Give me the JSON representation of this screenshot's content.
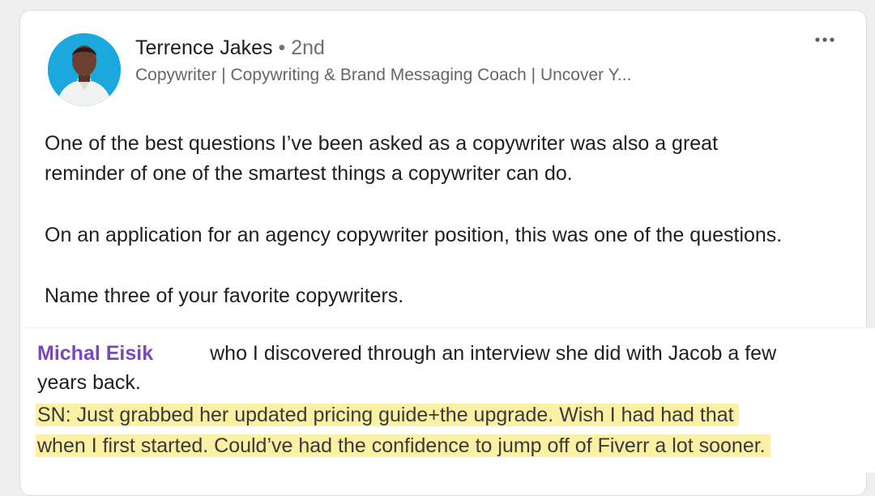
{
  "post": {
    "author": {
      "name": "Terrence Jakes",
      "separator": "•",
      "degree": "2nd",
      "headline": "Copywriter | Copywriting & Brand Messaging Coach | Uncover Y..."
    },
    "more_icon": "more-horizontal-icon",
    "body_lines": [
      "One of the best questions I’ve been asked as a copywriter was also a great",
      "reminder of one of the smartest things a copywriter can do.",
      "On an application for an agency copywriter position, this was one of the questions.",
      "Name three of your favorite copywriters."
    ]
  },
  "overlay": {
    "mention": "Michal Eisik",
    "line1_rest": "who I discovered through an interview she did with Jacob a few",
    "line2": "years back.",
    "highlight_lines": [
      "SN: Just grabbed her updated pricing guide+the upgrade. Wish I had had that",
      "when I first started. Could’ve had the confidence to jump off of Fiverr a lot sooner."
    ],
    "colors": {
      "mention": "#7a49b8",
      "highlight": "#fbf0a4"
    }
  }
}
